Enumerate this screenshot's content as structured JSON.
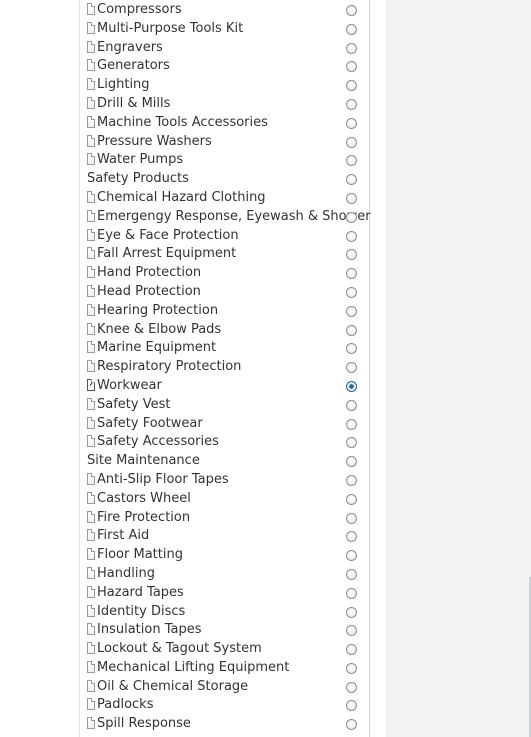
{
  "list": {
    "items": [
      {
        "label": "Compressors",
        "type": "item",
        "selected": false
      },
      {
        "label": "Multi-Purpose Tools Kit",
        "type": "item",
        "selected": false
      },
      {
        "label": "Engravers",
        "type": "item",
        "selected": false
      },
      {
        "label": "Generators",
        "type": "item",
        "selected": false
      },
      {
        "label": "Lighting",
        "type": "item",
        "selected": false
      },
      {
        "label": "Drill & Mills",
        "type": "item",
        "selected": false
      },
      {
        "label": "Machine Tools Accessories",
        "type": "item",
        "selected": false
      },
      {
        "label": "Pressure Washers",
        "type": "item",
        "selected": false
      },
      {
        "label": "Water Pumps",
        "type": "item",
        "selected": false
      },
      {
        "label": "Safety Products",
        "type": "category",
        "selected": false
      },
      {
        "label": "Chemical Hazard Clothing",
        "type": "item",
        "selected": false
      },
      {
        "label": "Emergengy Response, Eyewash & Shower",
        "type": "item",
        "selected": false
      },
      {
        "label": "Eye & Face Protection",
        "type": "item",
        "selected": false
      },
      {
        "label": "Fall Arrest Equipment",
        "type": "item",
        "selected": false
      },
      {
        "label": "Hand Protection",
        "type": "item",
        "selected": false
      },
      {
        "label": "Head Protection",
        "type": "item",
        "selected": false
      },
      {
        "label": "Hearing Protection",
        "type": "item",
        "selected": false
      },
      {
        "label": "Knee & Elbow Pads",
        "type": "item",
        "selected": false
      },
      {
        "label": "Marine Equipment",
        "type": "item",
        "selected": false
      },
      {
        "label": "Respiratory Protection",
        "type": "item",
        "selected": false
      },
      {
        "label": "Workwear",
        "type": "item",
        "selected": true
      },
      {
        "label": "Safety Vest",
        "type": "item",
        "selected": false
      },
      {
        "label": "Safety Footwear",
        "type": "item",
        "selected": false
      },
      {
        "label": "Safety Accessories",
        "type": "item",
        "selected": false
      },
      {
        "label": "Site Maintenance",
        "type": "category",
        "selected": false
      },
      {
        "label": "Anti-Slip Floor Tapes",
        "type": "item",
        "selected": false
      },
      {
        "label": "Castors Wheel",
        "type": "item",
        "selected": false
      },
      {
        "label": "Fire Protection",
        "type": "item",
        "selected": false
      },
      {
        "label": "First Aid",
        "type": "item",
        "selected": false
      },
      {
        "label": "Floor Matting",
        "type": "item",
        "selected": false
      },
      {
        "label": "Handling",
        "type": "item",
        "selected": false
      },
      {
        "label": "Hazard Tapes",
        "type": "item",
        "selected": false
      },
      {
        "label": "Identity Discs",
        "type": "item",
        "selected": false
      },
      {
        "label": "Insulation Tapes",
        "type": "item",
        "selected": false
      },
      {
        "label": "Lockout & Tagout System",
        "type": "item",
        "selected": false
      },
      {
        "label": "Mechanical Lifting Equipment",
        "type": "item",
        "selected": false
      },
      {
        "label": "Oil & Chemical Storage",
        "type": "item",
        "selected": false
      },
      {
        "label": "Padlocks",
        "type": "item",
        "selected": false
      },
      {
        "label": "Spill Response",
        "type": "item",
        "selected": false
      }
    ]
  },
  "icons": {
    "item": "document-icon",
    "item_selected": "document-edit-icon",
    "radio": "radio-button-icon"
  },
  "colors": {
    "text": "#333333",
    "radio_checked": "#2a6ea8",
    "right_background": "#f2f3f5"
  }
}
